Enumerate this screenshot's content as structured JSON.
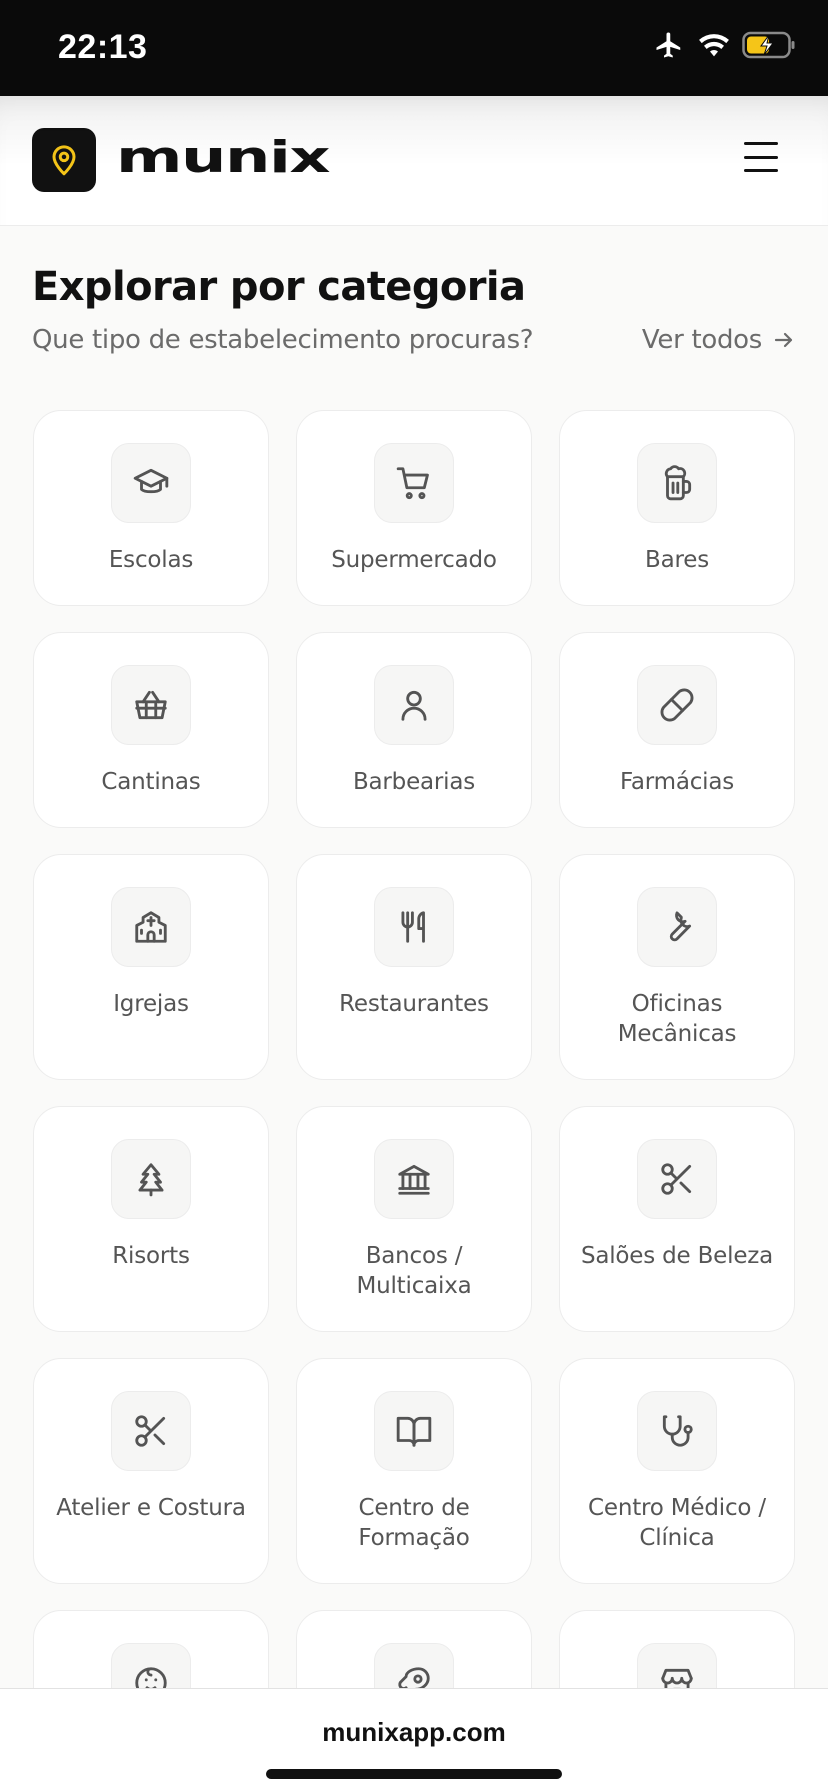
{
  "status_bar": {
    "time": "22:13",
    "icons": [
      "airplane-icon",
      "wifi-icon",
      "battery-charging-icon"
    ],
    "battery_color": "#f5c518"
  },
  "header": {
    "logo_icon": "map-pin-icon",
    "logo_accent": "#f5c518",
    "brand": "munix",
    "menu_icon": "hamburger-menu-icon"
  },
  "section": {
    "title": "Explorar por categoria",
    "subtitle": "Que tipo de estabelecimento procuras?",
    "see_all_label": "Ver todos",
    "see_all_icon": "arrow-right-icon"
  },
  "categories": [
    {
      "label": "Escolas",
      "icon": "graduation-cap-icon"
    },
    {
      "label": "Supermercado",
      "icon": "shopping-cart-icon"
    },
    {
      "label": "Bares",
      "icon": "beer-mug-icon"
    },
    {
      "label": "Cantinas",
      "icon": "basket-icon"
    },
    {
      "label": "Barbearias",
      "icon": "user-icon"
    },
    {
      "label": "Farmácias",
      "icon": "pill-icon"
    },
    {
      "label": "Igrejas",
      "icon": "church-icon"
    },
    {
      "label": "Restaurantes",
      "icon": "utensils-icon"
    },
    {
      "label": "Oficinas Mecânicas",
      "icon": "wrench-icon"
    },
    {
      "label": "Risorts",
      "icon": "tree-icon"
    },
    {
      "label": "Bancos / Multicaixa",
      "icon": "bank-icon"
    },
    {
      "label": "Salões de Beleza",
      "icon": "scissors-icon"
    },
    {
      "label": "Atelier e Costura",
      "icon": "scissors-icon"
    },
    {
      "label": "Centro de Formação",
      "icon": "book-open-icon"
    },
    {
      "label": "Centro Médico / Clínica",
      "icon": "stethoscope-icon"
    },
    {
      "label": "",
      "icon": "baby-face-icon"
    },
    {
      "label": "",
      "icon": "meat-icon"
    },
    {
      "label": "",
      "icon": "store-icon"
    }
  ],
  "browser": {
    "url": "munixapp.com"
  }
}
